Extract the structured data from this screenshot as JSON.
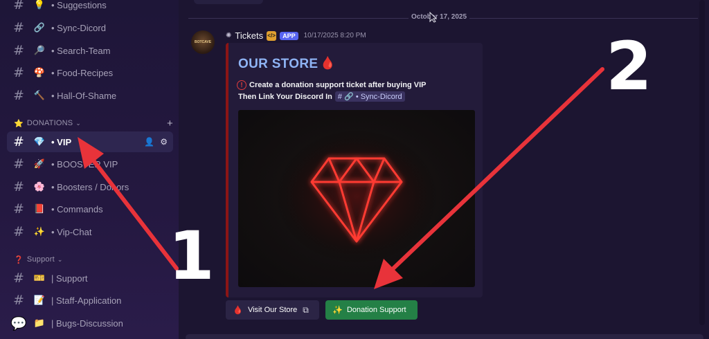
{
  "sidebar": {
    "channels_top": [
      {
        "emoji": "💡",
        "label": "• Suggestions"
      },
      {
        "emoji": "🔗",
        "label": "• Sync-Dicord"
      },
      {
        "emoji": "🔎",
        "label": "• Search-Team"
      },
      {
        "emoji": "🍄",
        "label": "• Food-Recipes"
      },
      {
        "emoji": "🔨",
        "label": "• Hall-Of-Shame"
      }
    ],
    "category_donations": {
      "icon": "⭐",
      "label": "DONATIONS"
    },
    "donation_channels": [
      {
        "emoji": "💎",
        "label": "• VIP"
      },
      {
        "emoji": "🚀",
        "label": "• BOOSTER VIP"
      },
      {
        "emoji": "🌸",
        "label": "• Boosters / Donors"
      },
      {
        "emoji": "📕",
        "label": "• Commands"
      },
      {
        "emoji": "✨",
        "label": "• Vip-Chat"
      }
    ],
    "category_support": {
      "icon": "❓",
      "label": "Support"
    },
    "support_channels": [
      {
        "emoji": "🎫",
        "label": "| Support"
      },
      {
        "emoji": "📝",
        "label": "| Staff-Application"
      },
      {
        "emoji": "📁",
        "label": "| Bugs-Discussion"
      }
    ],
    "hash_symbol": "#"
  },
  "main": {
    "date_divider": "October 17, 2025",
    "message": {
      "author": "Tickets",
      "app_tag": "APP",
      "timestamp": "10/17/2025 8:20 PM",
      "avatar_text": "BOTCAVE"
    },
    "embed": {
      "title": "OUR STORE",
      "title_emoji": "🩸",
      "warn_symbol": "!",
      "line1": "Create a donation support ticket after buying VIP",
      "line2_prefix": "Then Link Your Discord In",
      "mention": "# 🔗 • Sync-Dicord"
    },
    "buttons": {
      "store": {
        "emoji": "🩸",
        "label": "Visit Our Store",
        "ext_icon": "⧉"
      },
      "donate": {
        "emoji": "✨",
        "label": "Donation Support"
      }
    }
  },
  "annotations": {
    "label_1": "1",
    "label_2": "2",
    "arrow_color": "#e8333a"
  },
  "colors": {
    "accent_blue": "#5865f2",
    "success_green": "#248046",
    "embed_border": "#8b1515",
    "embed_title": "#8fb4f5"
  }
}
